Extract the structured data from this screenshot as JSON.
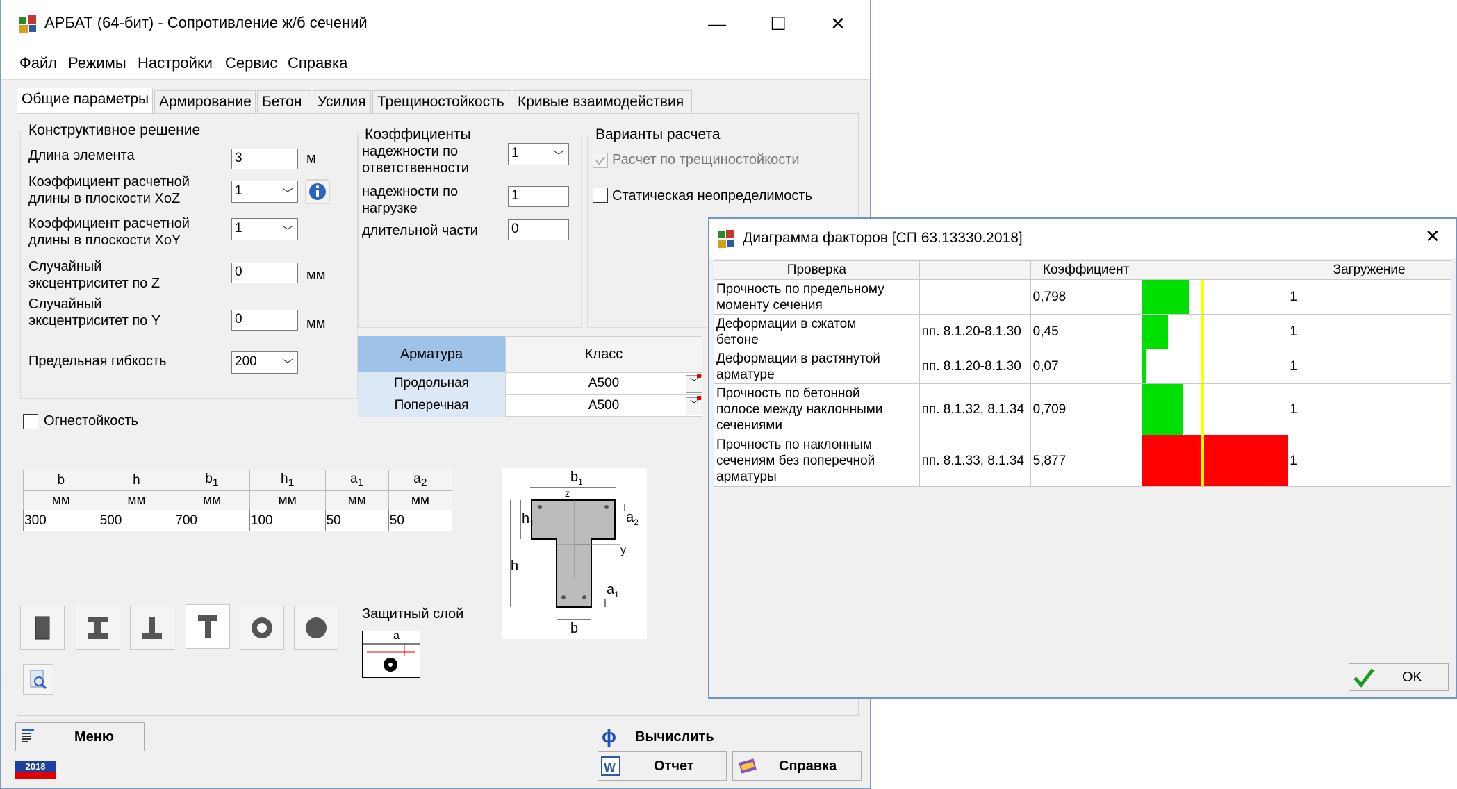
{
  "main": {
    "title": "АРБАТ (64-бит) - Сопротивление ж/б сечений",
    "window_controls": {
      "minimize": "—",
      "maximize": "☐",
      "close": "✕"
    },
    "menu": [
      "Файл",
      "Режимы",
      "Настройки",
      "Сервис",
      "Справка"
    ],
    "tabs": [
      "Общие параметры",
      "Армирование",
      "Бетон",
      "Усилия",
      "Трещиностойкость",
      "Кривые взаимодействия"
    ],
    "construct": {
      "title": "Конструктивное решение",
      "length_label": "Длина элемента",
      "length_value": "3",
      "length_unit": "м",
      "kz_label1": "Коэффициент расчетной",
      "kz_label2": "длины в плоскости XoZ",
      "kz_value": "1",
      "ky_label1": "Коэффициент расчетной",
      "ky_label2": "длины в плоскости XoY",
      "ky_value": "1",
      "ez_label1": "Случайный",
      "ez_label2": "эксцентриситет по Z",
      "ez_value": "0",
      "ez_unit": "мм",
      "ey_label1": "Случайный",
      "ey_label2": "эксцентриситет по Y",
      "ey_value": "0",
      "ey_unit": "мм",
      "flex_label": "Предельная гибкость",
      "flex_value": "200"
    },
    "coef": {
      "title": "Коэффициенты",
      "resp_label1": "надежности по",
      "resp_label2": "ответственности",
      "resp_value": "1",
      "load_label1": "надежности по",
      "load_label2": "нагрузке",
      "load_value": "1",
      "long_label": "длительной части",
      "long_value": "0"
    },
    "variants": {
      "title": "Варианты расчета",
      "crack": "Расчет по трещиностойкости",
      "static": "Статическая неопределимость"
    },
    "rebar_table": {
      "headers": [
        "Арматура",
        "Класс"
      ],
      "rows": [
        [
          "Продольная",
          "А500"
        ],
        [
          "Поперечная",
          "А500"
        ]
      ]
    },
    "fire": "Огнестойкость",
    "dims": {
      "headers": [
        "b",
        "h",
        "b",
        "h",
        "a",
        "a"
      ],
      "subs": [
        "",
        "",
        "1",
        "1",
        "1",
        "2"
      ],
      "units": [
        "мм",
        "мм",
        "мм",
        "мм",
        "мм",
        "мм"
      ],
      "values": [
        "300",
        "500",
        "700",
        "100",
        "50",
        "50"
      ]
    },
    "protect_label": "Защитный слой",
    "protect_letter": "a",
    "diagram_labels": {
      "b1": "b",
      "b1s": "1",
      "h1": "h",
      "h1s": "1",
      "h": "h",
      "b": "b",
      "z": "z",
      "y": "y",
      "a2": "a",
      "a2s": "2",
      "a1": "a",
      "a1s": "1"
    },
    "buttons": {
      "menu": "Меню",
      "calc": "Вычислить",
      "report": "Отчет",
      "help": "Справка",
      "year": "2018"
    }
  },
  "dialog": {
    "title": "Диаграмма факторов [СП 63.13330.2018]",
    "close": "✕",
    "headers": [
      "Проверка",
      "",
      "Коэффициент",
      "",
      "Загружение"
    ],
    "rows": [
      {
        "check": [
          "Прочность по предельному",
          "моменту сечения"
        ],
        "ref": "",
        "coef": "0,798",
        "value": 0.798,
        "load": "1"
      },
      {
        "check": [
          "Деформации в сжатом",
          "бетоне"
        ],
        "ref": "пп. 8.1.20-8.1.30",
        "coef": "0,45",
        "value": 0.45,
        "load": "1"
      },
      {
        "check": [
          "Деформации в растянутой",
          "арматуре"
        ],
        "ref": "пп. 8.1.20-8.1.30",
        "coef": "0,07",
        "value": 0.07,
        "load": "1"
      },
      {
        "check": [
          "Прочность по бетонной",
          "полосе между наклонными",
          "сечениями"
        ],
        "ref": "пп. 8.1.32, 8.1.34",
        "coef": "0,709",
        "value": 0.709,
        "load": "1"
      },
      {
        "check": [
          "Прочность по наклонным",
          "сечениям без поперечной",
          "арматуры"
        ],
        "ref": "пп. 8.1.33, 8.1.34",
        "coef": "5,877",
        "value": 5.877,
        "load": "1"
      }
    ],
    "ok": "OK",
    "colors": {
      "ok": "#00e000",
      "fail": "#ff0000",
      "limit": "#ffff00"
    }
  }
}
